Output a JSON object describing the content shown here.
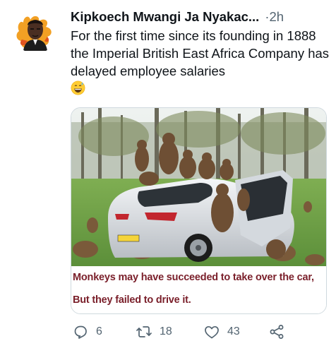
{
  "tweet": {
    "author_name": "Kipkoech Mwangi Ja Nyakac...",
    "separator": "·",
    "time": "2h",
    "text": "For the first time since its founding in 1888 the Imperial British East Africa Company has delayed employee salaries",
    "emoji": "grinning-face-with-sweat"
  },
  "media": {
    "caption_line_1": "Monkeys may have succeeded to take over the car,",
    "caption_line_2": "But they failed to drive it."
  },
  "actions": {
    "replies": "6",
    "retweets": "18",
    "likes": "43"
  },
  "icons": [
    "reply-icon",
    "retweet-icon",
    "like-icon",
    "share-icon"
  ],
  "colors": {
    "text": "#0f1419",
    "secondary": "#536471",
    "caption": "#7a1f2a",
    "border": "#cfd9de"
  }
}
